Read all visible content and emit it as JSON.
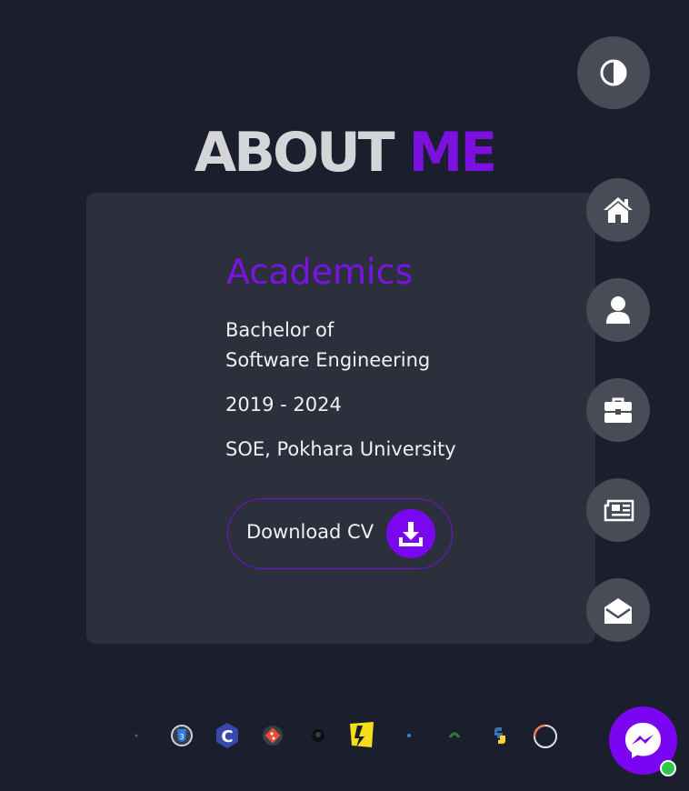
{
  "section": {
    "title_part1": "ABOUT",
    "title_part2": "ME"
  },
  "academics": {
    "heading": "Academics",
    "degree_line1": "Bachelor of",
    "degree_line2": "Software Engineering",
    "years": "2019 - 2024",
    "institution": "SOE, Pokhara University"
  },
  "cv_button": {
    "label": "Download CV",
    "icon": "download-icon"
  },
  "theme_toggle": {
    "icon": "contrast-icon"
  },
  "side_nav": [
    {
      "icon": "home-icon"
    },
    {
      "icon": "user-icon"
    },
    {
      "icon": "briefcase-icon"
    },
    {
      "icon": "newspaper-icon"
    },
    {
      "icon": "envelope-open-icon"
    }
  ],
  "skills": [
    {
      "icon": "html-icon"
    },
    {
      "icon": "css-icon"
    },
    {
      "icon": "c-language-icon"
    },
    {
      "icon": "git-icon"
    },
    {
      "icon": "github-icon"
    },
    {
      "icon": "javascript-icon"
    },
    {
      "icon": "react-icon"
    },
    {
      "icon": "mongodb-icon"
    },
    {
      "icon": "python-icon"
    },
    {
      "icon": "ring-icon"
    }
  ],
  "messenger": {
    "icon": "messenger-icon",
    "status": "online"
  },
  "colors": {
    "background": "#1b1e2d",
    "card": "#2c2f3c",
    "accent": "#7a07f0",
    "nav_button": "#474c56",
    "online": "#2ec94a"
  }
}
